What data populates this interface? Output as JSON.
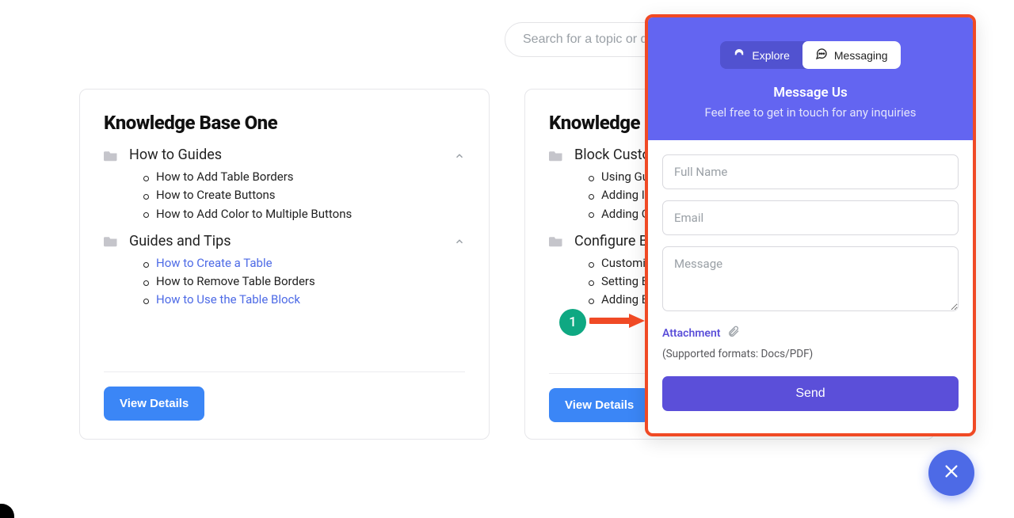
{
  "search": {
    "placeholder": "Search for a topic or question"
  },
  "kb_left": {
    "title": "Knowledge Base One",
    "sections": [
      {
        "title": "How to Guides",
        "items": [
          {
            "label": "How to Add Table Borders",
            "link": false
          },
          {
            "label": "How to Create Buttons",
            "link": false
          },
          {
            "label": "How to Add Color to Multiple Buttons",
            "link": false
          }
        ]
      },
      {
        "title": "Guides and Tips",
        "items": [
          {
            "label": "How to Create a Table",
            "link": true
          },
          {
            "label": "How to Remove Table Borders",
            "link": false
          },
          {
            "label": "How to Use the Table Block",
            "link": true
          }
        ]
      }
    ],
    "view_label": "View Details"
  },
  "kb_right": {
    "title": "Knowledge Base Two",
    "sections": [
      {
        "title": "Block Customization",
        "items": [
          {
            "label": "Using Gutenberg",
            "link": false
          },
          {
            "label": "Adding Images",
            "link": false
          },
          {
            "label": "Adding Gallery",
            "link": false
          }
        ]
      },
      {
        "title": "Configure Blocks",
        "items": [
          {
            "label": "Customizing Blocks",
            "link": false
          },
          {
            "label": "Setting Block Options",
            "link": false
          },
          {
            "label": "Adding Block Styles",
            "link": false
          }
        ]
      }
    ],
    "view_label": "View Details"
  },
  "chat": {
    "tabs": {
      "explore": "Explore",
      "messaging": "Messaging"
    },
    "title": "Message Us",
    "subtitle": "Feel free to get in touch for any inquiries",
    "fullname_placeholder": "Full Name",
    "email_placeholder": "Email",
    "message_placeholder": "Message",
    "attachment_label": "Attachment",
    "attachment_note": "(Supported formats: Docs/PDF)",
    "send_label": "Send"
  },
  "annotation": {
    "step": "1"
  },
  "colors": {
    "accent_blue": "#3b86f6",
    "chat_purple": "#6365f1",
    "chat_button": "#5b4fd9",
    "highlight_orange": "#f04a25",
    "link_blue": "#4d6ae6",
    "badge_green": "#0fa882"
  }
}
